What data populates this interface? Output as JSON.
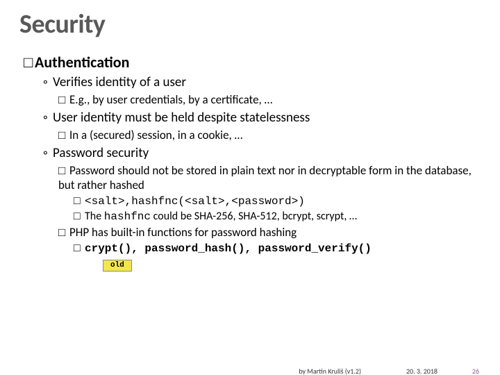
{
  "title": "Security",
  "h1": "Authentication",
  "b1": "Verifies identity of a user",
  "b1a": "E.g., by user credentials, by a certificate, …",
  "b2": "User identity must be held despite statelessness",
  "b2a": "In a (secured) session, in a cookie, …",
  "b3": "Password security",
  "b3a": "Password should not be stored in plain text nor in decryptable form in the database, but rather hashed",
  "b3b_code": "<salt>,hashfnc(<salt>,<password>)",
  "b3c_pre": "The ",
  "b3c_code": "hashfnc",
  "b3c_post": " could be SHA-256, SHA-512, bcrypt, scrypt, …",
  "b3d": "PHP has built-in functions for password hashing",
  "b3d1_code": "crypt(), password_hash(), password_verify()",
  "old": "old",
  "credit": "by Martin Kruliš (v1.2)",
  "date": "20. 3. 2018",
  "page": "26"
}
